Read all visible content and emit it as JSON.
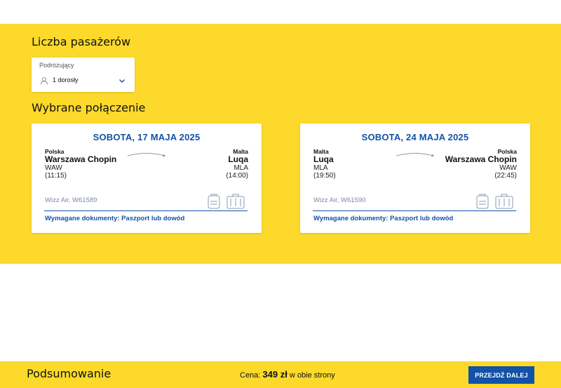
{
  "passengers": {
    "section_title": "Liczba pasażerów",
    "field_label": "Podróżujący",
    "value": "1 dorosły"
  },
  "selected": {
    "section_title": "Wybrane połączenie"
  },
  "flights": [
    {
      "date": "SOBOTA, 17 MAJA 2025",
      "origin": {
        "country": "Polska",
        "city": "Warszawa Chopin",
        "code": "WAW",
        "time": "(11:15)"
      },
      "destination": {
        "country": "Malta",
        "city": "Luqa",
        "code": "MLA",
        "time": "(14:00)"
      },
      "flight_no": "Wizz Air, W61589",
      "documents": "Wymagane dokumenty: Paszport lub dowód",
      "icons": [
        "backpack-icon",
        "suitcase-icon"
      ]
    },
    {
      "date": "SOBOTA, 24 MAJA 2025",
      "origin": {
        "country": "Malta",
        "city": "Luqa",
        "code": "MLA",
        "time": "(19:50)"
      },
      "destination": {
        "country": "Polska",
        "city": "Warszawa Chopin",
        "code": "WAW",
        "time": "(22:45)"
      },
      "flight_no": "Wizz Air, W61590",
      "documents": "Wymagane dokumenty: Paszport lub dowód",
      "icons": [
        "backpack-icon",
        "suitcase-icon"
      ]
    }
  ],
  "summary": {
    "title": "Podsumowanie",
    "price_prefix": "Cena:",
    "price": "349 zł",
    "price_suffix": "w obie strony",
    "next_button": "PRZEJDŹ DALEJ"
  },
  "colors": {
    "brand_yellow": "#fcd92a",
    "brand_blue": "#1352a8"
  }
}
